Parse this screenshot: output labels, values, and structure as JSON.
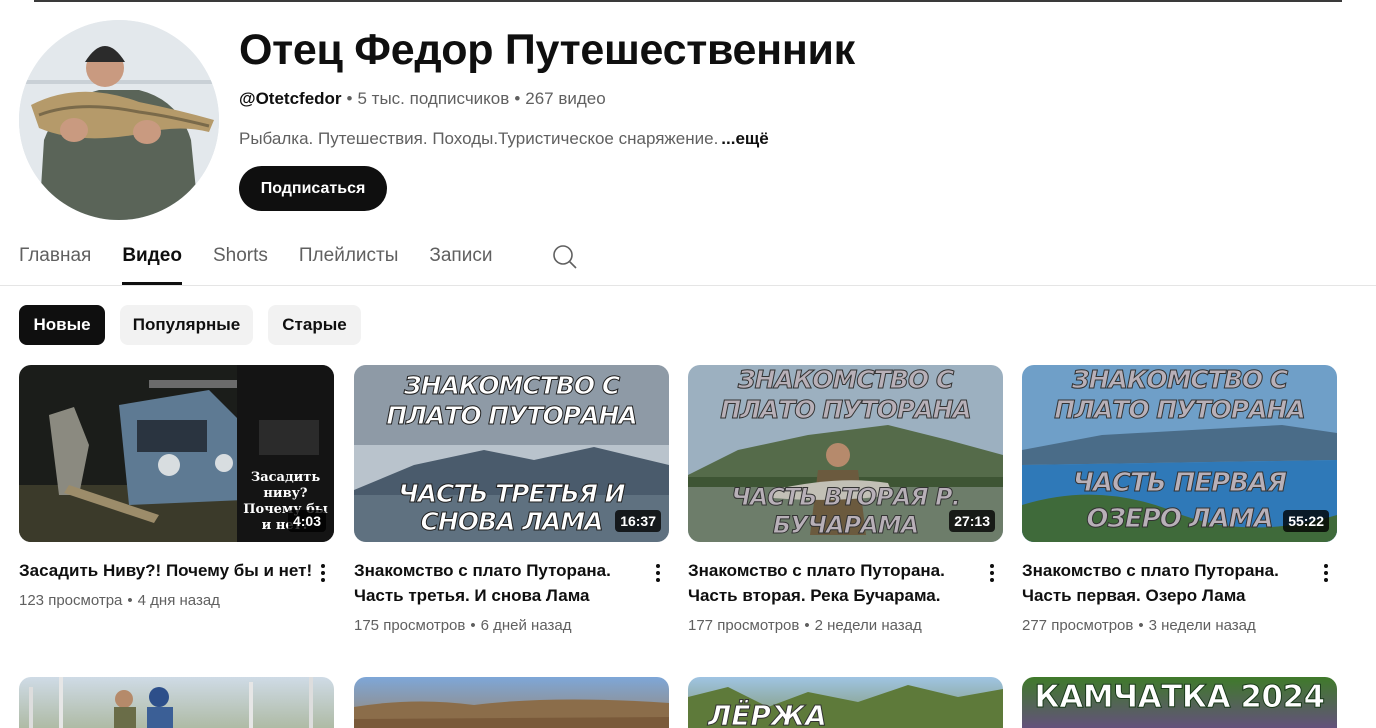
{
  "channel": {
    "name": "Отец Федор Путешественник",
    "handle": "@Otetcfedor",
    "subscribers": "5 тыс. подписчиков",
    "video_count": "267 видео",
    "meta_separator": "•",
    "description": "Рыбалка. Путешествия. Походы.Туристическое снаряжение.",
    "more_label": "...ещё",
    "subscribe_label": "Подписаться"
  },
  "tabs": [
    {
      "label": "Главная",
      "active": false
    },
    {
      "label": "Видео",
      "active": true
    },
    {
      "label": "Shorts",
      "active": false
    },
    {
      "label": "Плейлисты",
      "active": false
    },
    {
      "label": "Записи",
      "active": false
    }
  ],
  "chips": [
    {
      "label": "Новые",
      "active": true
    },
    {
      "label": "Популярные",
      "active": false
    },
    {
      "label": "Старые",
      "active": false
    }
  ],
  "videos": [
    {
      "title": "Засадить Ниву?! Почему бы и нет!",
      "views": "123 просмотра",
      "age": "4 дня назад",
      "duration": "4:03",
      "thumb_overlay": "Засадить ниву?Почему бы и нет?"
    },
    {
      "title": "Знакомство с плато Путорана. Часть третья. И снова Лама",
      "views": "175 просмотров",
      "age": "6 дней назад",
      "duration": "16:37",
      "thumb_top": "ЗНАКОМСТВО С ПЛАТО ПУТОРАНА",
      "thumb_bottom": "ЧАСТЬ ТРЕТЬЯ И СНОВА ЛАМА"
    },
    {
      "title": "Знакомство с плато Путорана. Часть вторая. Река Бучарама.",
      "views": "177 просмотров",
      "age": "2 недели назад",
      "duration": "27:13",
      "thumb_top": "ЗНАКОМСТВО С ПЛАТО ПУТОРАНА",
      "thumb_bottom": "ЧАСТЬ ВТОРАЯ Р. БУЧАРАМА"
    },
    {
      "title": "Знакомство с плато Путорана. Часть первая. Озеро Лама",
      "views": "277 просмотров",
      "age": "3 недели назад",
      "duration": "55:22",
      "thumb_top": "ЗНАКОМСТВО С ПЛАТО ПУТОРАНА",
      "thumb_bottom": "ЧАСТЬ ПЕРВАЯ ОЗЕРО ЛАМА"
    }
  ],
  "row2_overlays": [
    "",
    "",
    "ЛЁРЖА",
    "КАМЧАТКА 2024"
  ],
  "colors": {
    "text_primary": "#0f0f0f",
    "text_secondary": "#606060",
    "chip_bg": "#f2f2f2",
    "overlay_text": "#b8b0b8"
  },
  "icons": [
    "search-icon",
    "more-vert-icon"
  ]
}
